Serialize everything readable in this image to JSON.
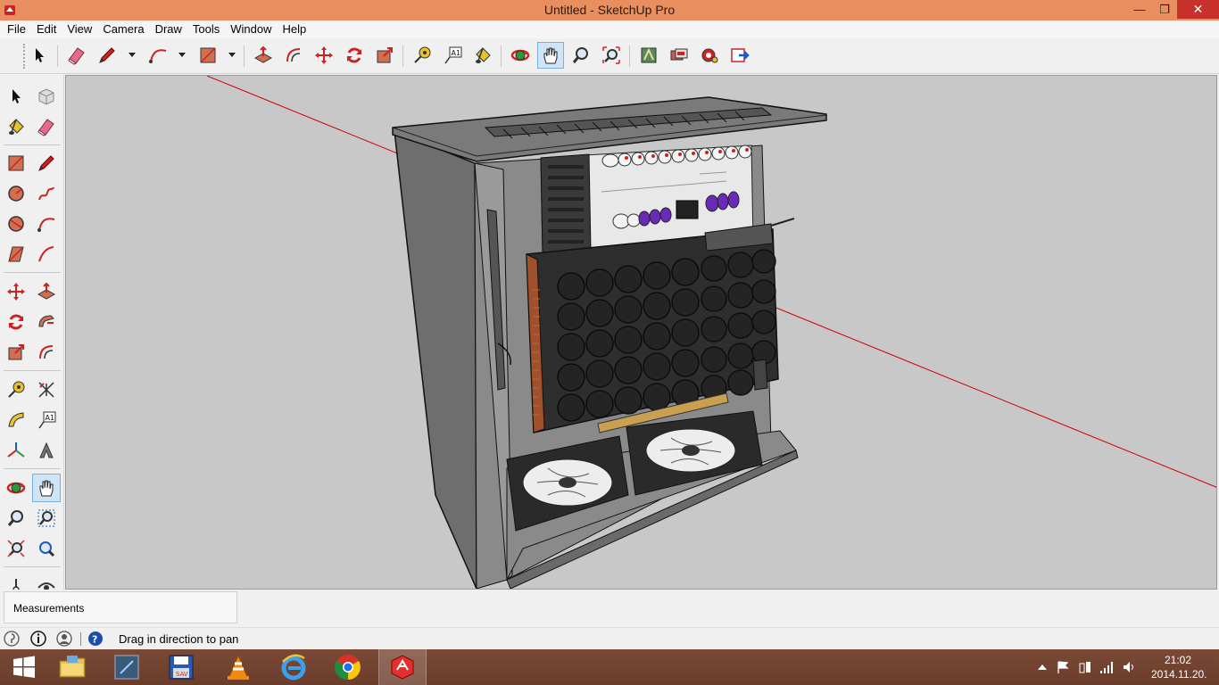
{
  "window": {
    "title": "Untitled - SketchUp Pro",
    "min_glyph": "—",
    "max_glyph": "❐",
    "close_glyph": "✕"
  },
  "menu": [
    "File",
    "Edit",
    "View",
    "Camera",
    "Draw",
    "Tools",
    "Window",
    "Help"
  ],
  "toolbar": {
    "tools": [
      "select-icon",
      "eraser-icon",
      "pencil-icon",
      "arc-icon",
      "rectangle-icon",
      "push-pull-icon",
      "offset-icon",
      "move-icon",
      "rotate-icon",
      "scale-icon",
      "tape-measure-icon",
      "text-icon",
      "paint-bucket-icon",
      "orbit-icon",
      "pan-icon",
      "zoom-icon",
      "zoom-extents-icon",
      "3d-warehouse-icon",
      "extension-warehouse-icon",
      "components-icon",
      "layout-icon"
    ],
    "active": "pan-icon"
  },
  "measurements": {
    "label": "Measurements",
    "value": ""
  },
  "status": {
    "hint": "Drag in direction to pan"
  },
  "taskbar": {
    "apps": [
      "start-icon",
      "file-explorer-icon",
      "app-icon",
      "save-disk-icon",
      "vlc-icon",
      "internet-explorer-icon",
      "chrome-icon",
      "sketchup-icon"
    ],
    "active": "sketchup-icon",
    "clock_time": "21:02",
    "clock_date": "2014.11.20."
  },
  "colors": {
    "titlebar": "#e98e5e",
    "close": "#c7302b",
    "taskbar": "#6a3c2a",
    "viewport": "#c8c8c8",
    "active_tool": "#cfe4f7",
    "axis_red": "#d00000"
  }
}
